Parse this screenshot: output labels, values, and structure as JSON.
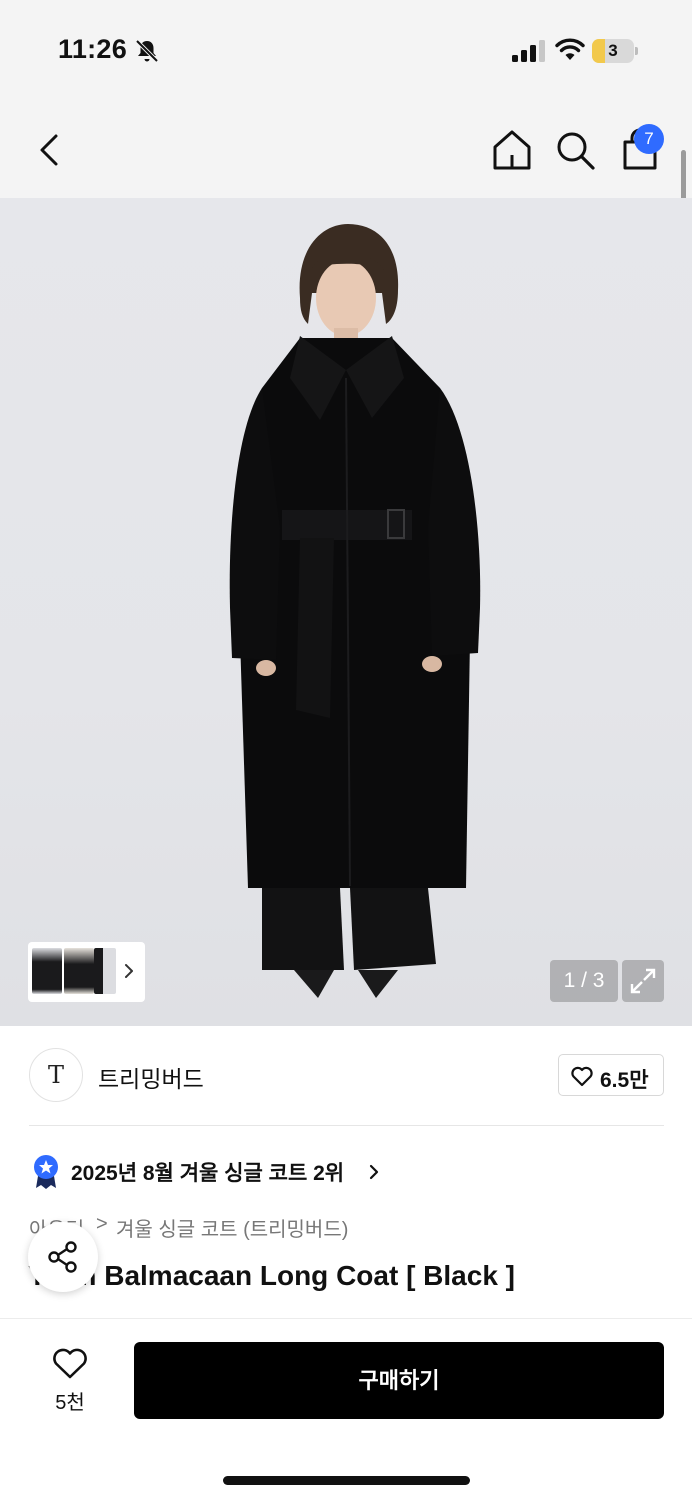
{
  "status_bar": {
    "time": "11:26",
    "battery_level": "3",
    "battery_fraction": 0.3,
    "icons": [
      "bell-off-icon",
      "cellular-signal-icon",
      "wifi-icon",
      "battery-icon"
    ]
  },
  "nav": {
    "icons": [
      "back-arrow-icon",
      "home-icon",
      "search-icon",
      "shopping-bag-icon"
    ],
    "cart_count": "7"
  },
  "gallery": {
    "counter": "1 / 3",
    "icons": [
      "expand-icon",
      "chevron-right-icon"
    ],
    "colors": {
      "background": "#e5e6ea",
      "coat": "#0b0b0c"
    }
  },
  "brand": {
    "logo_text": "T",
    "name": "트리밍버드",
    "like_count": "6.5만"
  },
  "ranking": {
    "text": "2025년 8월 겨울 싱글 코트 2위",
    "badge_color": "#2f6bff"
  },
  "breadcrumb": {
    "level1": "아우터",
    "separator": ">",
    "level2": "겨울 싱글 코트 (트리밍버드)"
  },
  "product": {
    "title": "Ylum Balmacaan Long Coat [ Black ]"
  },
  "bottom_bar": {
    "wish_count": "5천",
    "buy_label": "구매하기"
  }
}
